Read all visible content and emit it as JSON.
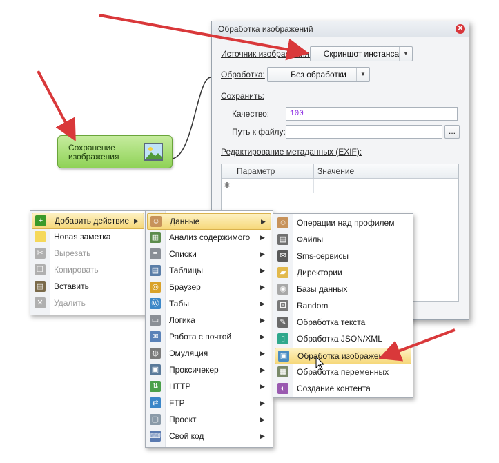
{
  "dialog": {
    "title": "Обработка изображений",
    "source_label": "Источник изображения:",
    "source_value": "Скриншот инстанса",
    "processing_label": "Обработка:",
    "processing_value": "Без обработки",
    "save_label": "Сохранить:",
    "quality_label": "Качество:",
    "quality_value": "100",
    "path_label": "Путь к файлу:",
    "path_value": "",
    "browse_label": "...",
    "exif_label": "Редактирование метаданных (EXIF):",
    "grid_columns": [
      "Параметр",
      "Значение"
    ],
    "new_row_marker": "✱"
  },
  "node": {
    "label": "Сохранение изображения"
  },
  "context_menu": [
    {
      "label": "Добавить действие",
      "icon": "plus-icon",
      "highlighted": true,
      "submenu": true
    },
    {
      "label": "Новая заметка",
      "icon": "note-icon"
    },
    {
      "label": "Вырезать",
      "icon": "scissors-icon",
      "disabled": true
    },
    {
      "label": "Копировать",
      "icon": "copy-icon",
      "disabled": true
    },
    {
      "label": "Вставить",
      "icon": "paste-icon"
    },
    {
      "label": "Удалить",
      "icon": "delete-icon",
      "disabled": true
    }
  ],
  "actions_menu": [
    {
      "label": "Данные",
      "icon": "user-icon",
      "highlighted": true
    },
    {
      "label": "Анализ содержимого",
      "icon": "analysis-icon"
    },
    {
      "label": "Списки",
      "icon": "list-icon"
    },
    {
      "label": "Таблицы",
      "icon": "table-icon"
    },
    {
      "label": "Браузер",
      "icon": "browser-icon"
    },
    {
      "label": "Табы",
      "icon": "tabs-icon"
    },
    {
      "label": "Логика",
      "icon": "logic-icon"
    },
    {
      "label": "Работа с почтой",
      "icon": "mail-icon"
    },
    {
      "label": "Эмуляция",
      "icon": "mouse-icon"
    },
    {
      "label": "Проксичекер",
      "icon": "proxy-icon"
    },
    {
      "label": "HTTP",
      "icon": "http-icon"
    },
    {
      "label": "FTP",
      "icon": "ftp-icon"
    },
    {
      "label": "Проект",
      "icon": "project-icon"
    },
    {
      "label": "Свой код",
      "icon": "code-icon"
    }
  ],
  "data_menu": [
    {
      "label": "Операции над профилем",
      "icon": "profile-icon"
    },
    {
      "label": "Файлы",
      "icon": "file-icon"
    },
    {
      "label": "Sms-сервисы",
      "icon": "sms-icon"
    },
    {
      "label": "Директории",
      "icon": "folder-icon"
    },
    {
      "label": "Базы данных",
      "icon": "database-icon"
    },
    {
      "label": "Random",
      "icon": "dice-icon"
    },
    {
      "label": "Обработка текста",
      "icon": "pen-icon"
    },
    {
      "label": "Обработка JSON/XML",
      "icon": "json-icon"
    },
    {
      "label": "Обработка изображений",
      "icon": "image-icon",
      "highlighted": true
    },
    {
      "label": "Обработка переменных",
      "icon": "variables-icon"
    },
    {
      "label": "Создание контента",
      "icon": "content-icon"
    }
  ],
  "colors": {
    "arrow": "#d9383a",
    "node_fill": "#a8de72",
    "highlight": "#f6d87a"
  }
}
